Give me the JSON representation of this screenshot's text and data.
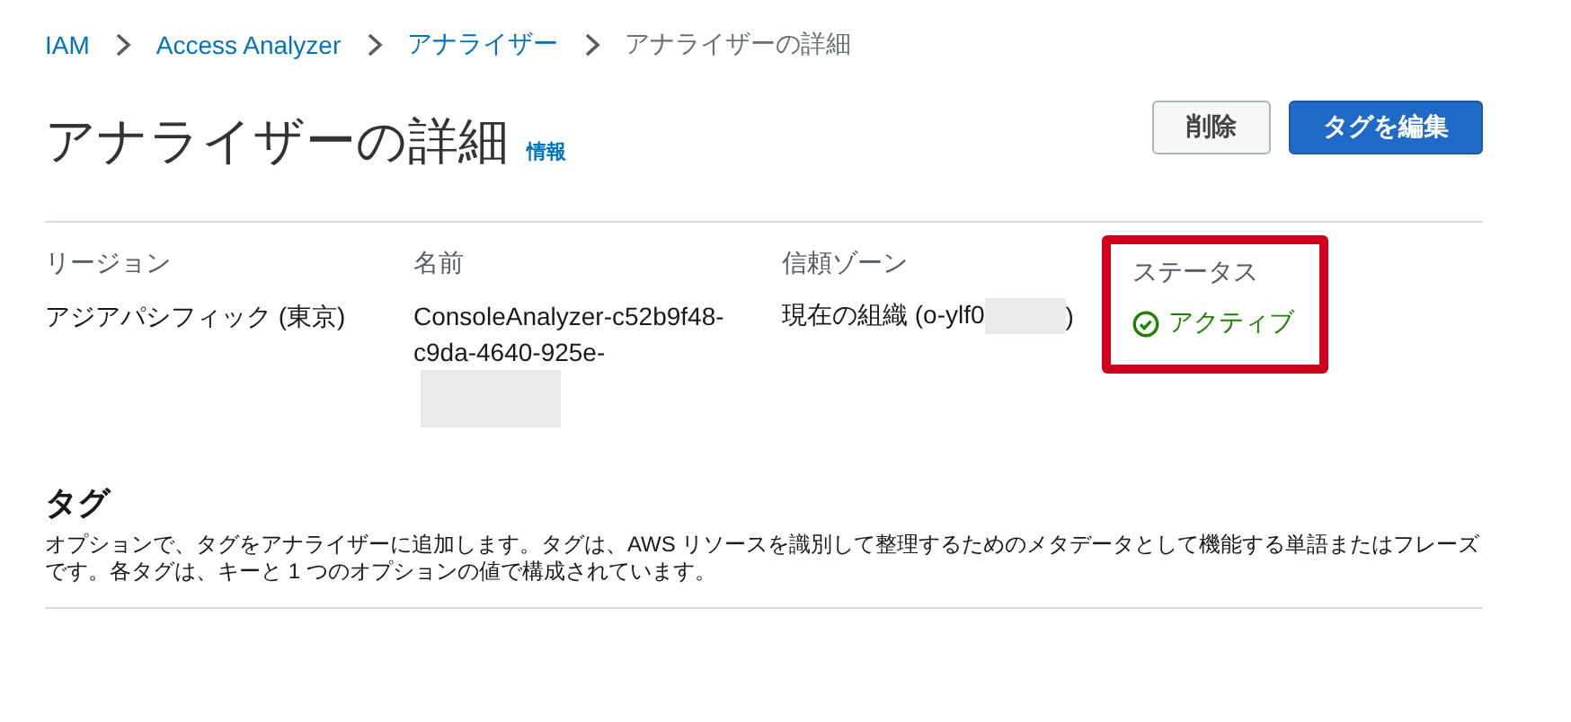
{
  "breadcrumb": [
    {
      "label": "IAM",
      "kind": "link"
    },
    {
      "label": "Access Analyzer",
      "kind": "link"
    },
    {
      "label": "アナライザー",
      "kind": "link"
    },
    {
      "label": "アナライザーの詳細",
      "kind": "current"
    }
  ],
  "page_title": "アナライザーの詳細",
  "info_link": "情報",
  "buttons": [
    {
      "label": "削除",
      "kind": "secondary"
    },
    {
      "label": "タグを編集",
      "kind": "primary"
    }
  ],
  "details": [
    {
      "label": "リージョン",
      "value": "アジアパシフィック (東京)",
      "kind": "text"
    },
    {
      "label": "名前",
      "value": "ConsoleAnalyzer-c52b9f48-c9da-4640-925e-",
      "kind": "redacted-below"
    },
    {
      "label": "信頼ゾーン",
      "value": "現在の組織 (o-ylf0",
      "value_end": ")",
      "kind": "redacted-inline"
    },
    {
      "label": "ステータス",
      "value": "アクティブ",
      "kind": "status",
      "highlighted": true
    }
  ],
  "tags_section": {
    "title": "タグ",
    "description": "オプションで、タグをアナライザーに追加します。タグは、AWS リソースを識別して整理するためのメタデータとして機能する単語またはフレーズです。各タグは、キーと 1 つのオプションの値で構成されています。"
  }
}
